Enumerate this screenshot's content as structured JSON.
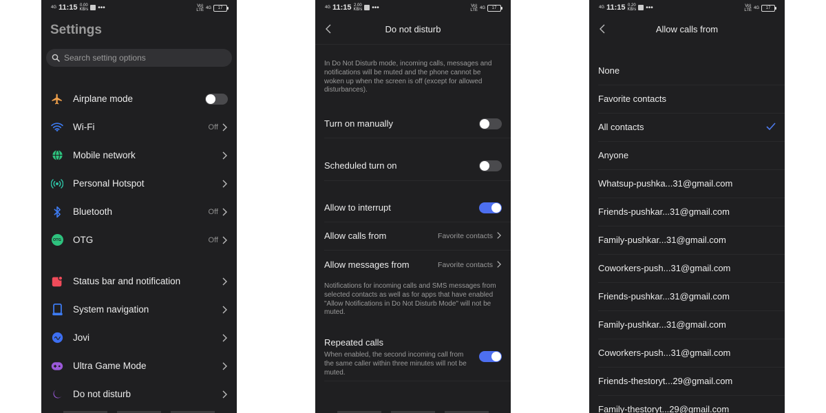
{
  "status_bar": {
    "signal": "4G",
    "time": "11:15",
    "p1_speed": "0.00",
    "p1_speed_unit": "KB/s",
    "p2_speed": "2.00",
    "p2_speed_unit": "KB/s",
    "p3_speed": "0.20",
    "p3_speed_unit": "KB/s",
    "dots": "•••",
    "net_top": "Vo)",
    "net_bottom": "LTE",
    "net_type": "4G",
    "battery": "17"
  },
  "settings": {
    "title": "Settings",
    "search_placeholder": "Search setting options",
    "items": [
      {
        "label": "Airplane mode",
        "icon": "airplane-icon",
        "color": "#f0a04b"
      },
      {
        "label": "Wi-Fi",
        "value": "Off",
        "icon": "wifi-icon",
        "color": "#3d7bf2"
      },
      {
        "label": "Mobile network",
        "icon": "globe-icon",
        "color": "#2ec27e"
      },
      {
        "label": "Personal Hotspot",
        "icon": "hotspot-icon",
        "color": "#2ec2a5"
      },
      {
        "label": "Bluetooth",
        "value": "Off",
        "icon": "bluetooth-icon",
        "color": "#3d7bf2"
      },
      {
        "label": "OTG",
        "value": "Off",
        "icon": "otg-icon",
        "color": "#2ec27e",
        "icon_text": "OTG"
      },
      {
        "label": "Status bar and notification",
        "icon": "notification-icon",
        "color": "#f04b5a"
      },
      {
        "label": "System navigation",
        "icon": "navigation-icon",
        "color": "#3d7bf2"
      },
      {
        "label": "Jovi",
        "icon": "jovi-icon",
        "color": "#3d6ff2"
      },
      {
        "label": "Ultra Game Mode",
        "icon": "gamepad-icon",
        "color": "#9b59d9"
      },
      {
        "label": "Do not disturb",
        "icon": "moon-icon",
        "color": "#9b59d9"
      }
    ]
  },
  "dnd": {
    "title": "Do not disturb",
    "intro": "In Do Not Disturb mode, incoming calls, messages and notifications will be muted and the phone cannot be woken up when the screen is off (except for allowed disturbances).",
    "turn_on_manually": "Turn on manually",
    "scheduled_turn_on": "Scheduled turn on",
    "allow_to_interrupt": "Allow to interrupt",
    "allow_calls_from": "Allow calls from",
    "allow_calls_value": "Favorite contacts",
    "allow_messages_from": "Allow messages from",
    "allow_messages_value": "Favorite contacts",
    "notifications_note": "Notifications for incoming calls and SMS messages from selected contacts as well as for apps that have enabled \"Allow Notifications in Do Not Disturb Mode\" will not be muted.",
    "repeated_calls": "Repeated calls",
    "repeated_calls_desc": "When enabled, the second incoming call from the same caller within three minutes will not be muted.",
    "accent": "#4d6ff0"
  },
  "allow_calls": {
    "title": "Allow calls from",
    "options": [
      {
        "label": "None",
        "selected": false
      },
      {
        "label": "Favorite contacts",
        "selected": false
      },
      {
        "label": "All contacts",
        "selected": true
      },
      {
        "label": "Anyone",
        "selected": false
      },
      {
        "label": "Whatsup-pushka...31@gmail.com",
        "selected": false
      },
      {
        "label": "Friends-pushkar...31@gmail.com",
        "selected": false
      },
      {
        "label": "Family-pushkar...31@gmail.com",
        "selected": false
      },
      {
        "label": "Coworkers-push...31@gmail.com",
        "selected": false
      },
      {
        "label": "Friends-pushkar...31@gmail.com",
        "selected": false
      },
      {
        "label": "Family-pushkar...31@gmail.com",
        "selected": false
      },
      {
        "label": "Coworkers-push...31@gmail.com",
        "selected": false
      },
      {
        "label": "Friends-thestoryt...29@gmail.com",
        "selected": false
      },
      {
        "label": "Family-thestoryt...29@gmail.com",
        "selected": false
      }
    ],
    "check_color": "#4d7bf0"
  }
}
